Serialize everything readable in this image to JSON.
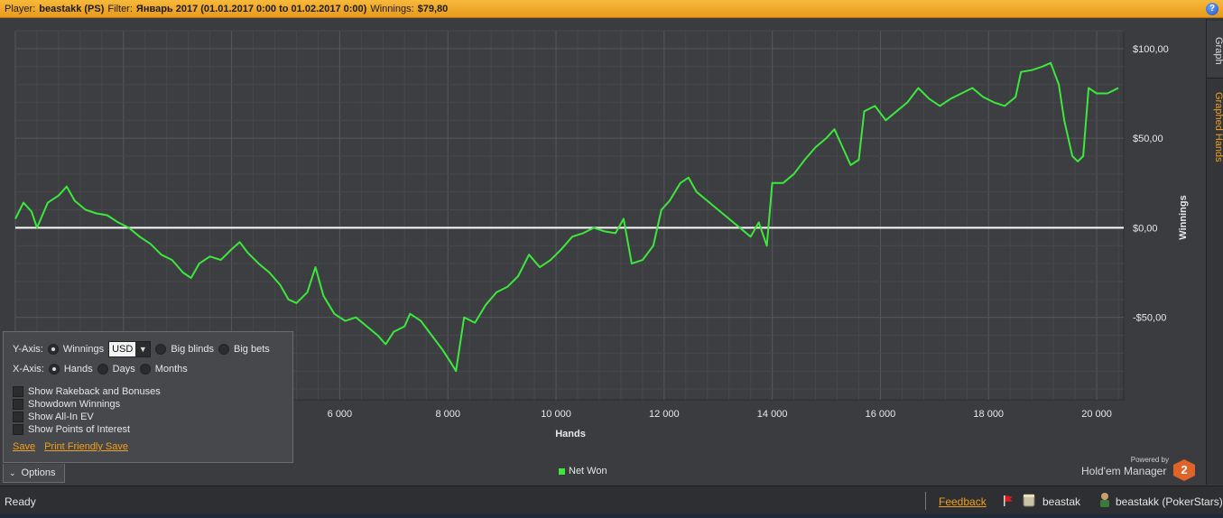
{
  "header": {
    "player_label": "Player:",
    "player_value": "beastakk (PS)",
    "filter_label": "Filter:",
    "filter_value": "Январь 2017 (01.01.2017 0:00 to 01.02.2017 0:00)",
    "winnings_label": "Winnings:",
    "winnings_value": "$79,80",
    "help_icon": "?"
  },
  "right_tabs": [
    "Graph",
    "Graphed Hands"
  ],
  "options": {
    "yaxis_label": "Y-Axis:",
    "y_options": [
      "Winnings",
      "Big blinds",
      "Big bets"
    ],
    "y_selected": "Winnings",
    "currency": "USD",
    "xaxis_label": "X-Axis:",
    "x_options": [
      "Hands",
      "Days",
      "Months"
    ],
    "x_selected": "Hands",
    "checkboxes": [
      "Show Rakeback and Bonuses",
      "Showdown Winnings",
      "Show All-In EV",
      "Show Points of Interest"
    ],
    "save": "Save",
    "print_save": "Print Friendly Save",
    "tab_label": "Options"
  },
  "powered": {
    "small": "Powered by",
    "brand": "Hold'em Manager",
    "logo": "2"
  },
  "status": {
    "ready": "Ready",
    "feedback": "Feedback",
    "user1": "beastak",
    "user2": "beastakk (PokerStars)"
  },
  "colors": {
    "series": "#3ce83c",
    "zero_line": "#ffffff",
    "accent": "#f0a020"
  },
  "chart_data": {
    "type": "line",
    "title": "",
    "xlabel": "Hands",
    "ylabel": "Winnings",
    "x_ticks": [
      "6 000",
      "8 000",
      "10 000",
      "12 000",
      "14 000",
      "16 000",
      "18 000",
      "20 000"
    ],
    "y_ticks": [
      "$100,00",
      "$50,00",
      "$0,00",
      "-$50,00"
    ],
    "xlim": [
      0,
      20500
    ],
    "ylim": [
      -96,
      110
    ],
    "grid": true,
    "legend": "bottom",
    "series": [
      {
        "name": "Net Won",
        "color": "#3ce83c",
        "points": [
          [
            0,
            5
          ],
          [
            150,
            14
          ],
          [
            300,
            9
          ],
          [
            400,
            0
          ],
          [
            600,
            14
          ],
          [
            800,
            18
          ],
          [
            950,
            23
          ],
          [
            1100,
            15
          ],
          [
            1300,
            10
          ],
          [
            1500,
            8
          ],
          [
            1700,
            7
          ],
          [
            1900,
            3
          ],
          [
            2100,
            0
          ],
          [
            2300,
            -5
          ],
          [
            2500,
            -9
          ],
          [
            2700,
            -15
          ],
          [
            2900,
            -18
          ],
          [
            3100,
            -25
          ],
          [
            3250,
            -28
          ],
          [
            3400,
            -20
          ],
          [
            3600,
            -16
          ],
          [
            3800,
            -18
          ],
          [
            4000,
            -12
          ],
          [
            4150,
            -8
          ],
          [
            4300,
            -14
          ],
          [
            4500,
            -20
          ],
          [
            4700,
            -25
          ],
          [
            4900,
            -32
          ],
          [
            5050,
            -40
          ],
          [
            5200,
            -42
          ],
          [
            5400,
            -36
          ],
          [
            5550,
            -22
          ],
          [
            5700,
            -38
          ],
          [
            5900,
            -48
          ],
          [
            6100,
            -52
          ],
          [
            6300,
            -50
          ],
          [
            6500,
            -55
          ],
          [
            6700,
            -60
          ],
          [
            6850,
            -65
          ],
          [
            7000,
            -58
          ],
          [
            7200,
            -55
          ],
          [
            7300,
            -48
          ],
          [
            7500,
            -52
          ],
          [
            7700,
            -60
          ],
          [
            7900,
            -68
          ],
          [
            8050,
            -75
          ],
          [
            8150,
            -80
          ],
          [
            8300,
            -50
          ],
          [
            8500,
            -53
          ],
          [
            8700,
            -43
          ],
          [
            8900,
            -36
          ],
          [
            9100,
            -33
          ],
          [
            9300,
            -27
          ],
          [
            9500,
            -15
          ],
          [
            9700,
            -22
          ],
          [
            9900,
            -18
          ],
          [
            10100,
            -12
          ],
          [
            10300,
            -5
          ],
          [
            10500,
            -3
          ],
          [
            10700,
            0
          ],
          [
            10900,
            -2
          ],
          [
            11100,
            -3
          ],
          [
            11250,
            5
          ],
          [
            11400,
            -20
          ],
          [
            11600,
            -18
          ],
          [
            11800,
            -10
          ],
          [
            11950,
            10
          ],
          [
            12100,
            15
          ],
          [
            12300,
            25
          ],
          [
            12450,
            28
          ],
          [
            12600,
            20
          ],
          [
            12800,
            15
          ],
          [
            13000,
            10
          ],
          [
            13200,
            5
          ],
          [
            13400,
            0
          ],
          [
            13600,
            -5
          ],
          [
            13750,
            3
          ],
          [
            13900,
            -10
          ],
          [
            14000,
            25
          ],
          [
            14200,
            25
          ],
          [
            14400,
            30
          ],
          [
            14600,
            38
          ],
          [
            14800,
            45
          ],
          [
            15000,
            50
          ],
          [
            15150,
            55
          ],
          [
            15300,
            45
          ],
          [
            15450,
            35
          ],
          [
            15600,
            38
          ],
          [
            15700,
            65
          ],
          [
            15900,
            68
          ],
          [
            16100,
            60
          ],
          [
            16300,
            65
          ],
          [
            16500,
            70
          ],
          [
            16700,
            78
          ],
          [
            16900,
            72
          ],
          [
            17100,
            68
          ],
          [
            17300,
            72
          ],
          [
            17500,
            75
          ],
          [
            17700,
            78
          ],
          [
            17900,
            73
          ],
          [
            18100,
            70
          ],
          [
            18300,
            68
          ],
          [
            18500,
            73
          ],
          [
            18600,
            87
          ],
          [
            18800,
            88
          ],
          [
            19000,
            90
          ],
          [
            19150,
            92
          ],
          [
            19300,
            80
          ],
          [
            19400,
            60
          ],
          [
            19550,
            40
          ],
          [
            19650,
            37
          ],
          [
            19750,
            40
          ],
          [
            19850,
            78
          ],
          [
            20000,
            75
          ],
          [
            20200,
            75
          ],
          [
            20400,
            78
          ]
        ]
      }
    ]
  }
}
